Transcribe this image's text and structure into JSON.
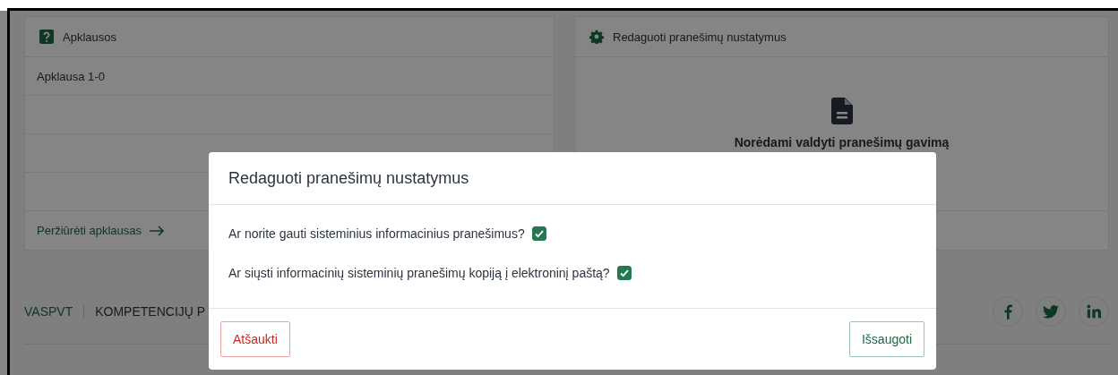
{
  "polls_card": {
    "title": "Apklausos",
    "rows": [
      "Apklausa 1-0"
    ],
    "link": "Peržiūrėti apklausas"
  },
  "settings_card": {
    "title": "Redaguoti pranešimų nustatymus",
    "message": "Norėdami valdyti pranešimų gavimą"
  },
  "footer": {
    "links": [
      "VASPVT",
      "KOMPETENCIJŲ P"
    ]
  },
  "modal": {
    "title": "Redaguoti pranešimų nustatymus",
    "options": [
      {
        "label": "Ar norite gauti sisteminius informacinius pranešimus?",
        "checked": true
      },
      {
        "label": "Ar siųsti informacinių sisteminių pranešimų kopiją į elektroninį paštą?",
        "checked": true
      }
    ],
    "cancel": "Atšaukti",
    "save": "Išsaugoti"
  }
}
